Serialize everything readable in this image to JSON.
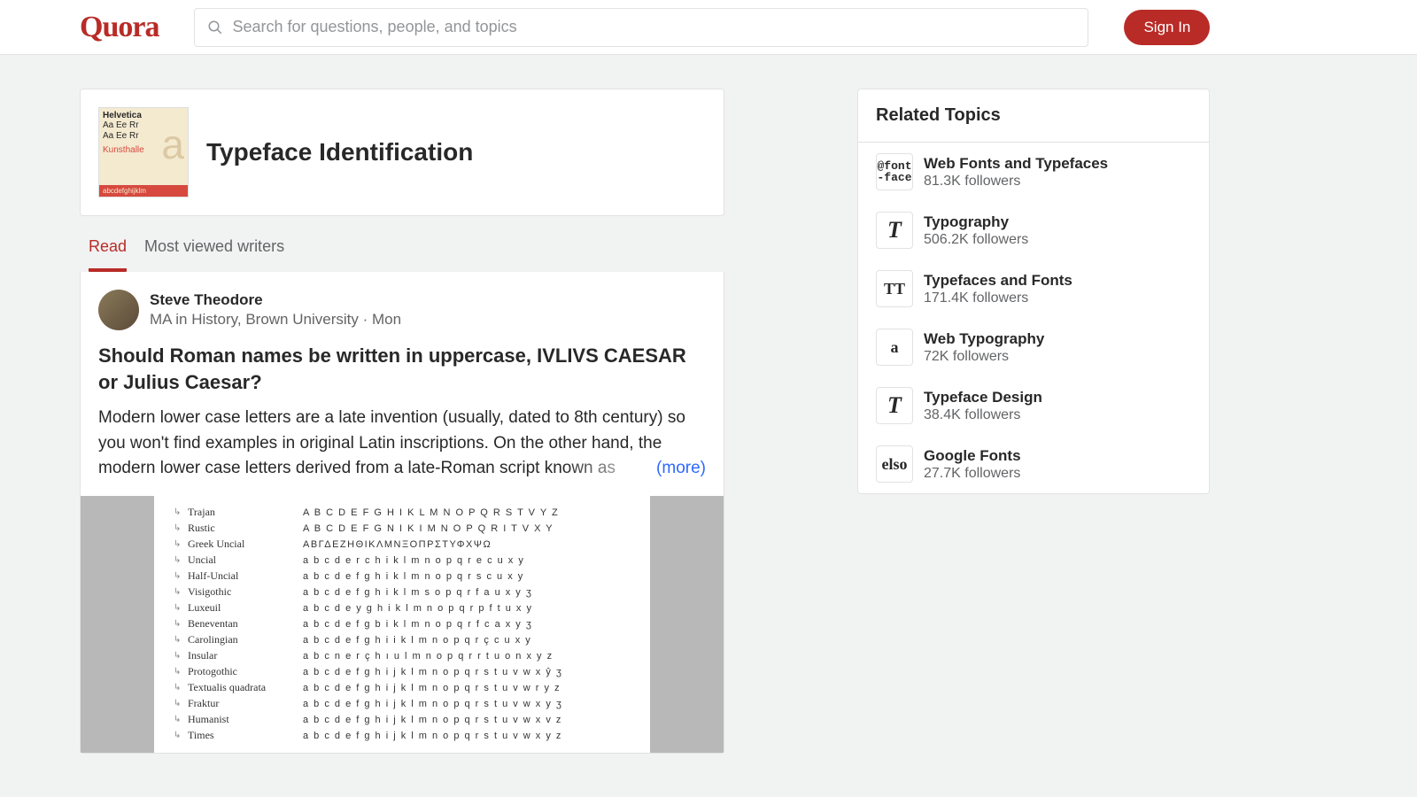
{
  "header": {
    "logo_text": "Quora",
    "search_placeholder": "Search for questions, people, and topics",
    "signin_label": "Sign In"
  },
  "topic": {
    "title": "Typeface Identification",
    "image": {
      "helvetica": "Helvetica",
      "sample": "Aa Ee Rr",
      "kunsthalle": "Kunsthalle",
      "alphabet": "abcdefghijklm",
      "big_letter": "a"
    }
  },
  "tabs": {
    "read": "Read",
    "writers": "Most viewed writers"
  },
  "post": {
    "author": "Steve Theodore",
    "credentials": "MA in History, Brown University · Mon",
    "title": "Should Roman names be written in uppercase, IVLIVS CAESAR or Julius Caesar?",
    "body": "Modern lower case letters are a late invention (usually, dated to 8th century) so you won't find examples in original Latin inscriptions. On the other hand, the modern lower case letters derived from a late-Roman script known as",
    "more": "(more)",
    "script_rows": [
      {
        "label": "Trajan",
        "letters": "A B C D E F G H I   K L M N O P Q R S T   V     Y Z"
      },
      {
        "label": "Rustic",
        "letters": "A B C D E F G N I   K I M N O P Q R I T   V   X Y"
      },
      {
        "label": "Greek Uncial",
        "letters": "ΑΒΓΔΕΖΗΘΙΚΛΜΝΞΟΠΡΣΤΥΦΧΨΩ"
      },
      {
        "label": "Uncial",
        "letters": "a b c d e r c h i   k l m n o p q r e c u     x y"
      },
      {
        "label": "Half-Uncial",
        "letters": "a b c d e f g h i   k l m n o p q r s c u     x y"
      },
      {
        "label": "Visigothic",
        "letters": "a b c d e f g h i   k l m s o p q r f a u     x y ʒ"
      },
      {
        "label": "Luxeuil",
        "letters": "a b c d e y g h i   k l m n o p q r p f t u     x y"
      },
      {
        "label": "Beneventan",
        "letters": "a b c d e f g b i   k l m n o p q r f c a     x y ʒ"
      },
      {
        "label": "Carolingian",
        "letters": "a b c d e f g h i i k l m n o p q r ç c u     x y"
      },
      {
        "label": "Insular",
        "letters": "a b c n e r ç h ı   u l m n o p q r r t u o n x y z"
      },
      {
        "label": "Protogothic",
        "letters": "a b c d e f g h i j k l m n o p q r s t u v w x ŷ ʒ"
      },
      {
        "label": "Textualis quadrata",
        "letters": "a b c d e f g h i j k l m n o p q r s t u v w r y z"
      },
      {
        "label": "Fraktur",
        "letters": "a b c d e f g h i j k l m n o p q r s t u v w x y ʒ"
      },
      {
        "label": "Humanist",
        "letters": "a b c d e f g h i j k l m n o p q r s t u v w x v z"
      },
      {
        "label": "Times",
        "letters": "a b c d e f g h i j k l m n o p q r  s t u v w x y z"
      }
    ]
  },
  "related": {
    "heading": "Related Topics",
    "items": [
      {
        "name": "Web Fonts and Typefaces",
        "followers": "81.3K followers",
        "icon_text": "@font\n-face",
        "icon_class": "mono"
      },
      {
        "name": "Typography",
        "followers": "506.2K followers",
        "icon_text": "T",
        "icon_class": "italic"
      },
      {
        "name": "Typefaces and Fonts",
        "followers": "171.4K followers",
        "icon_text": "TT",
        "icon_class": ""
      },
      {
        "name": "Web Typography",
        "followers": "72K followers",
        "icon_text": "a",
        "icon_class": ""
      },
      {
        "name": "Typeface Design",
        "followers": "38.4K followers",
        "icon_text": "T",
        "icon_class": "italic"
      },
      {
        "name": "Google Fonts",
        "followers": "27.7K followers",
        "icon_text": "elso",
        "icon_class": ""
      }
    ]
  }
}
